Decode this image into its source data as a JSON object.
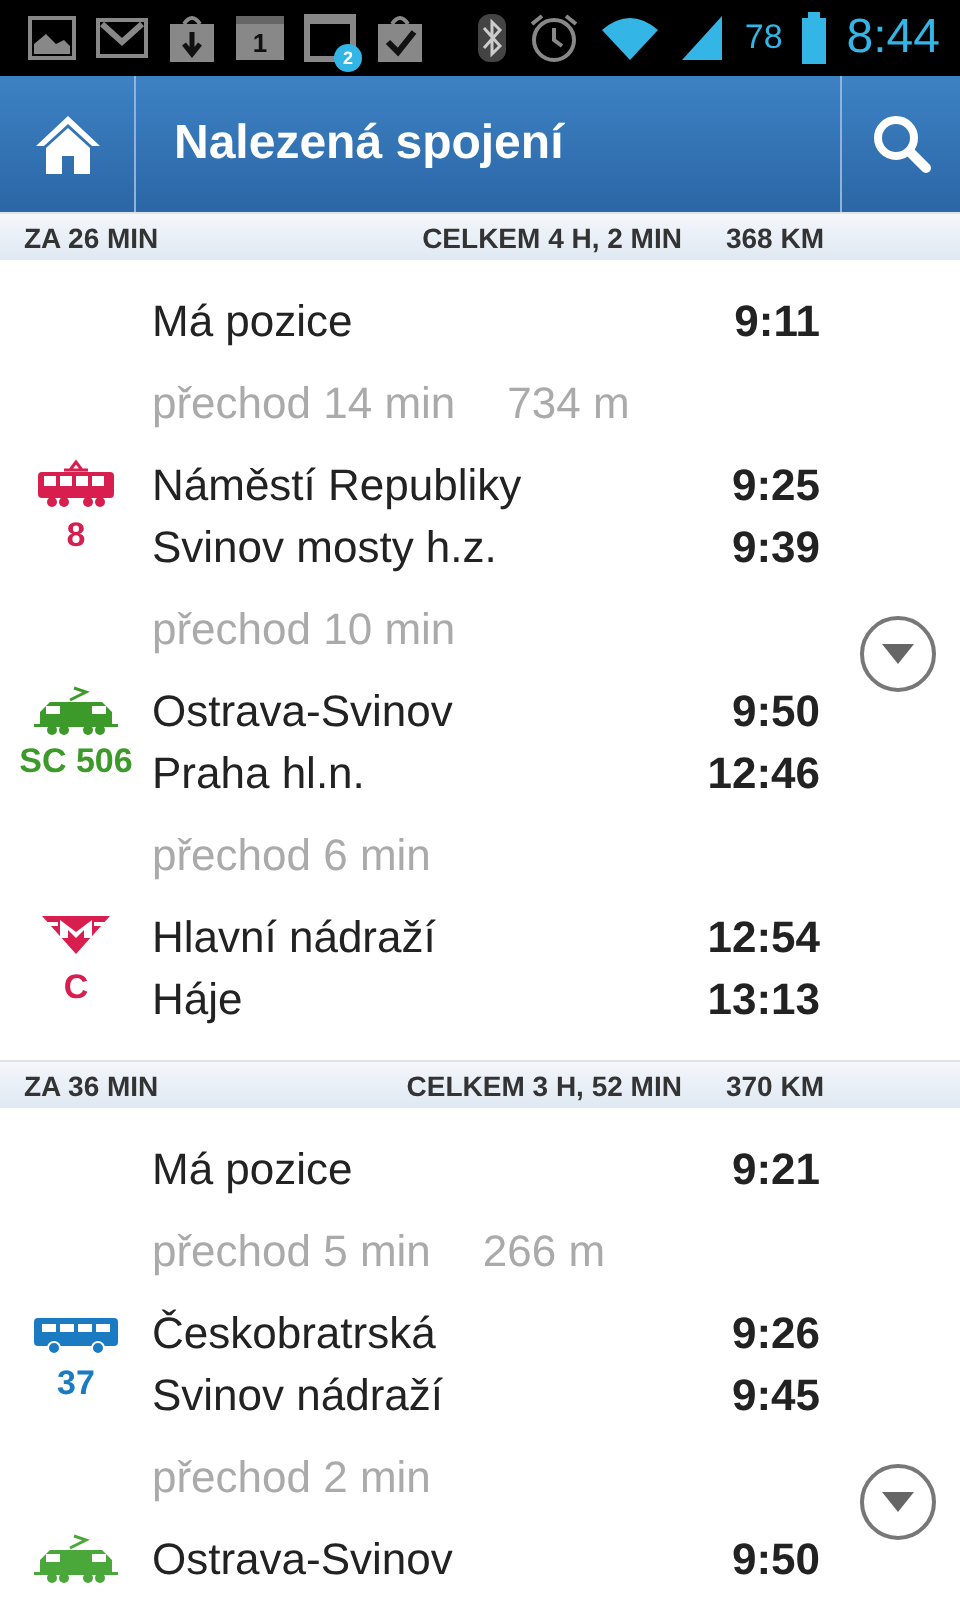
{
  "status_bar": {
    "calendar_day": "1",
    "badge": "2",
    "battery": "78",
    "time": "8:44"
  },
  "header": {
    "title": "Nalezená spojení"
  },
  "connections": [
    {
      "summary": {
        "departs_in": "ZA  26 MIN",
        "total": "CELKEM  4 H, 2 MIN",
        "distance": "368 KM"
      },
      "legs": [
        {
          "kind": "place",
          "name": "Má pozice",
          "time": "9:11"
        },
        {
          "kind": "transfer",
          "text": "přechod 14 min",
          "distance": "734 m"
        },
        {
          "kind": "tram",
          "line": "8",
          "color": "#d81e4f",
          "from": "Náměstí Republiky",
          "from_time": "9:25",
          "to": "Svinov mosty h.z.",
          "to_time": "9:39"
        },
        {
          "kind": "transfer",
          "text": "přechod 10 min"
        },
        {
          "kind": "train",
          "line": "SC 506",
          "color": "#3c9a2a",
          "from": "Ostrava-Svinov",
          "from_time": "9:50",
          "to": "Praha hl.n.",
          "to_time": "12:46"
        },
        {
          "kind": "transfer",
          "text": "přechod 6 min"
        },
        {
          "kind": "metro",
          "line": "C",
          "color": "#d81e4f",
          "from": "Hlavní nádraží",
          "from_time": "12:54",
          "to": "Háje",
          "to_time": "13:13"
        }
      ]
    },
    {
      "summary": {
        "departs_in": "ZA  36 MIN",
        "total": "CELKEM  3 H, 52 MIN",
        "distance": "370 KM"
      },
      "legs": [
        {
          "kind": "place",
          "name": "Má pozice",
          "time": "9:21"
        },
        {
          "kind": "transfer",
          "text": "přechod 5 min",
          "distance": "266 m"
        },
        {
          "kind": "bus",
          "line": "37",
          "color": "#1b7bc2",
          "from": "Českobratrská",
          "from_time": "9:26",
          "to": "Svinov nádraží",
          "to_time": "9:45"
        },
        {
          "kind": "transfer",
          "text": "přechod 2 min"
        },
        {
          "kind": "train",
          "color": "#4aa83a",
          "from": "Ostrava-Svinov",
          "from_time": "9:50"
        }
      ]
    }
  ]
}
